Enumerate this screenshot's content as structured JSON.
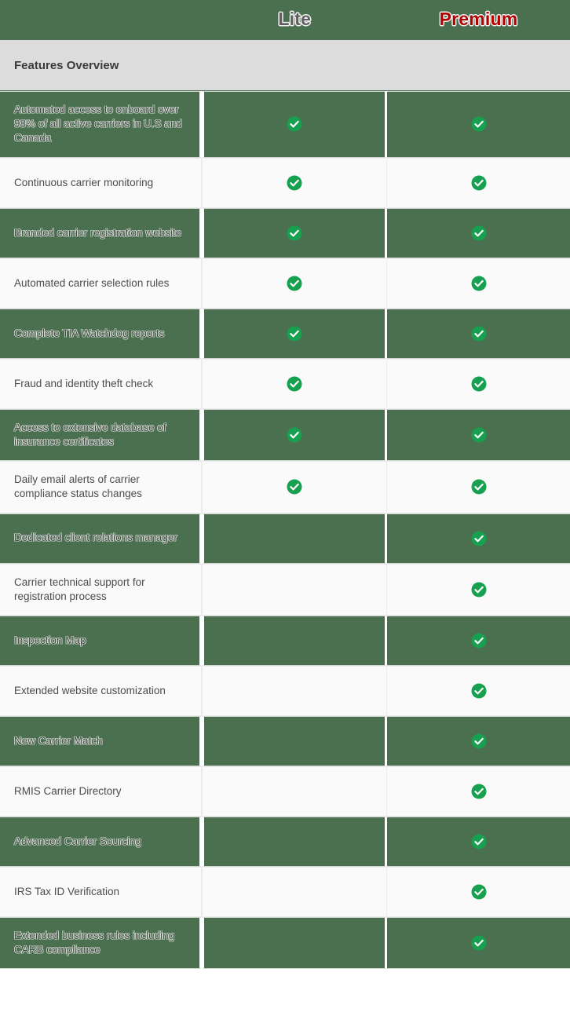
{
  "header": {
    "plans": [
      {
        "name": "Lite",
        "color": "#5f5f5f",
        "key": "lite"
      },
      {
        "name": "Premium",
        "color": "#b10000",
        "key": "premium"
      }
    ]
  },
  "section": {
    "title": "Features Overview"
  },
  "colors": {
    "green_row": "#4a7050",
    "white_row": "#fafafa",
    "section_bg": "#dcdcdc",
    "check_green": "#17a04f",
    "premium_red": "#b10000",
    "lite_gray": "#5f5f5f"
  },
  "icons": {
    "check": "check-circle-icon"
  },
  "rows": [
    {
      "feature": "Automated access to onboard over 98% of all active carriers in U.S and Canada",
      "lite": true,
      "premium": true,
      "style": "green"
    },
    {
      "feature": "Continuous carrier monitoring",
      "lite": true,
      "premium": true,
      "style": "white"
    },
    {
      "feature": "Branded carrier registration website",
      "lite": true,
      "premium": true,
      "style": "green"
    },
    {
      "feature": "Automated carrier selection rules",
      "lite": true,
      "premium": true,
      "style": "white"
    },
    {
      "feature": "Complete TIA Watchdog reports",
      "lite": true,
      "premium": true,
      "style": "green"
    },
    {
      "feature": "Fraud and identity theft check",
      "lite": true,
      "premium": true,
      "style": "white"
    },
    {
      "feature": "Access to extensive database of insurance certificates",
      "lite": true,
      "premium": true,
      "style": "green"
    },
    {
      "feature": "Daily email alerts of carrier compliance status changes",
      "lite": true,
      "premium": true,
      "style": "white"
    },
    {
      "feature": "Dedicated client relations manager",
      "lite": false,
      "premium": true,
      "style": "green"
    },
    {
      "feature": "Carrier technical support for registration process",
      "lite": false,
      "premium": true,
      "style": "white"
    },
    {
      "feature": "Inspection Map",
      "lite": false,
      "premium": true,
      "style": "green"
    },
    {
      "feature": "Extended website customization",
      "lite": false,
      "premium": true,
      "style": "white"
    },
    {
      "feature": "New Carrier Match",
      "lite": false,
      "premium": true,
      "style": "green"
    },
    {
      "feature": "RMIS Carrier Directory",
      "lite": false,
      "premium": true,
      "style": "white"
    },
    {
      "feature": "Advanced Carrier Sourcing",
      "lite": false,
      "premium": true,
      "style": "green"
    },
    {
      "feature": "IRS Tax ID Verification",
      "lite": false,
      "premium": true,
      "style": "white"
    },
    {
      "feature": "Extended business rules including CARB compliance",
      "lite": false,
      "premium": true,
      "style": "green"
    }
  ]
}
